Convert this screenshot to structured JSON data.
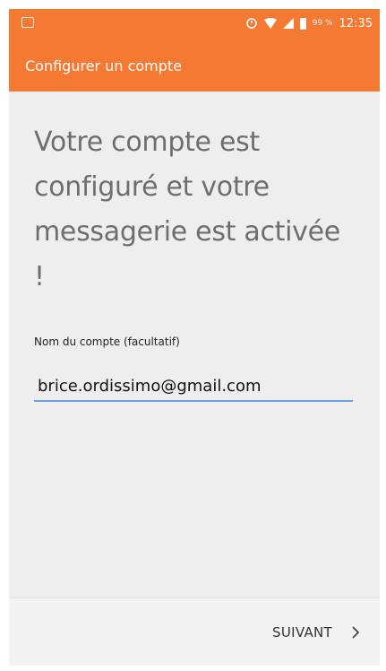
{
  "status_bar": {
    "battery_percent": "99 %",
    "time": "12:35",
    "icons": [
      "notification-icon",
      "alarm-icon",
      "wifi-icon",
      "signal-icon",
      "battery-icon"
    ]
  },
  "toolbar": {
    "title": "Configurer un compte"
  },
  "main": {
    "headline": "Votre compte est configuré et votre messagerie est activée !",
    "account_name_label": "Nom du compte (facultatif)",
    "account_name_value": "brice.ordissimo@gmail.com"
  },
  "footer": {
    "next_label": "SUIVANT",
    "next_icon": "chevron-right-icon"
  },
  "colors": {
    "accent": "#f47a33",
    "input_underline": "#6ea0e6",
    "background": "#eeeeee"
  }
}
